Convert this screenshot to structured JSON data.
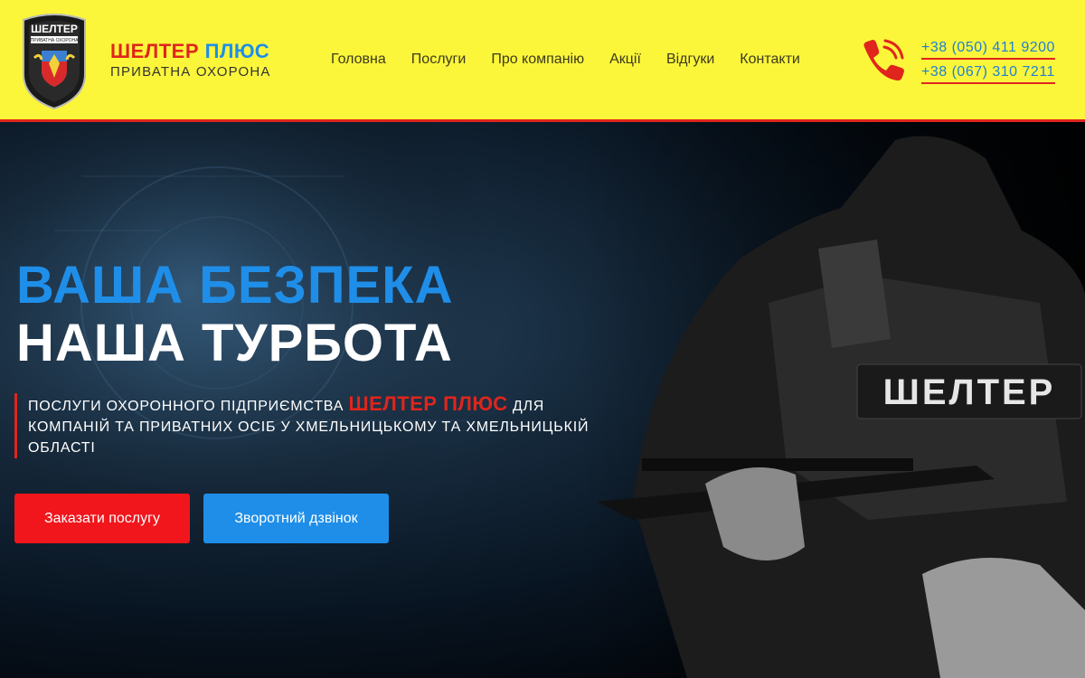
{
  "header": {
    "logo_badge_text": "ШЕЛТЕР",
    "logo_badge_subtext": "ПРИВАТНА ОХОРОНА",
    "brand_title_part1": "ШЕЛТЕР",
    "brand_title_part2": "ПЛЮС",
    "brand_subtitle": "ПРИВАТНА ОХОРОНА",
    "nav": [
      "Головна",
      "Послуги",
      "Про компанію",
      "Акції",
      "Відгуки",
      "Контакти"
    ],
    "phones": [
      "+38 (050) 411 9200",
      "+38 (067) 310 7211"
    ]
  },
  "hero": {
    "title_line1": "ВАША БЕЗПЕКА",
    "title_line2": "НАША ТУРБОТА",
    "desc_before": "ПОСЛУГИ ОХОРОННОГО ПІДПРИЄМСТВА ",
    "desc_brand": "ШЕЛТЕР ПЛЮС",
    "desc_after": " ДЛЯ КОМПАНІЙ ТА ПРИВАТНИХ ОСІБ У ХМЕЛЬНИЦЬКОМУ ТА ХМЕЛЬНИЦЬКІЙ ОБЛАСТІ",
    "button_order": "Заказати послугу",
    "button_callback": "Зворотний дзвінок",
    "vest_patch_text": "ШЕЛТЕР"
  },
  "colors": {
    "header_bg": "#fbf63a",
    "accent_red": "#e0251c",
    "accent_blue": "#1f8ee8"
  },
  "icons": [
    "logo-shield-icon",
    "phone-icon"
  ]
}
